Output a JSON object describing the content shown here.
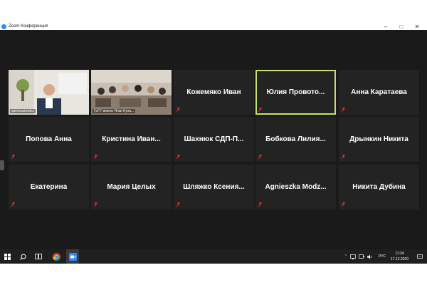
{
  "window": {
    "title": "Zoom Конференция"
  },
  "participants": [
    {
      "name": "",
      "video_label": "spresnarowicz"
    },
    {
      "name": "",
      "video_label": "ГрГУ имени Янки Купа..."
    },
    {
      "name": "Кожемяко Иван"
    },
    {
      "name": "Юлия  Провото...",
      "active": true
    },
    {
      "name": "Анна Каратаева"
    },
    {
      "name": "Попова Анна"
    },
    {
      "name": "Кристина  Иван..."
    },
    {
      "name": "Шахнюк  СДП-П..."
    },
    {
      "name": "Бобкова  Лилия..."
    },
    {
      "name": "Дрынкин Никита"
    },
    {
      "name": "Екатерина"
    },
    {
      "name": "Мария Целых"
    },
    {
      "name": "Шляжко  Ксения..."
    },
    {
      "name": "Agnieszka  Modz..."
    },
    {
      "name": "Никита Дубина"
    }
  ],
  "taskbar": {
    "language": "РУС",
    "time": "11:34",
    "date": "17.12.2020"
  },
  "colors": {
    "active_border": "#c5e06b",
    "muted_mic": "#e03030",
    "tile_bg": "#232323",
    "stage_bg": "#1a1a1a"
  }
}
